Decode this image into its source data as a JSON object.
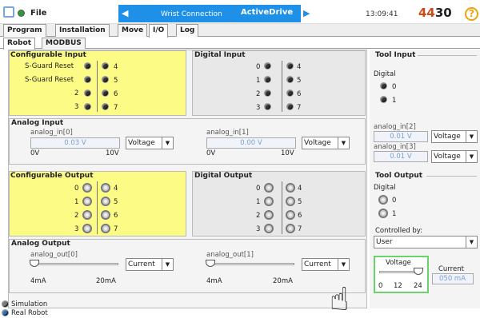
{
  "header": {
    "file_label": "File",
    "tab_wrist": "Wrist Connection",
    "tab_active": "ActiveDrive",
    "clock": "13:09:41",
    "speed_main": "4430",
    "help": "?"
  },
  "tabs": [
    "Program",
    "Installation",
    "Move",
    "I/O",
    "Log"
  ],
  "subtabs": [
    "Robot",
    "MODBUS"
  ],
  "config_input": {
    "title": "Configurable Input",
    "rows": [
      {
        "label": "S-Guard Reset",
        "right": "4"
      },
      {
        "label": "S-Guard Reset",
        "right": "5"
      },
      {
        "label": "2",
        "right": "6"
      },
      {
        "label": "3",
        "right": "7"
      }
    ]
  },
  "digital_input": {
    "title": "Digital Input",
    "rows": [
      {
        "left": "0",
        "right": "4"
      },
      {
        "left": "1",
        "right": "5"
      },
      {
        "left": "2",
        "right": "6"
      },
      {
        "left": "3",
        "right": "7"
      }
    ]
  },
  "tool_input": {
    "title": "Tool Input",
    "digital_label": "Digital",
    "items": [
      "0",
      "1"
    ],
    "analog0_label": "analog_in[2]",
    "analog0_value": "0.01 V",
    "analog0_mode": "Voltage",
    "analog1_label": "analog_in[3]",
    "analog1_value": "0.01 V",
    "analog1_mode": "Voltage"
  },
  "analog_input": {
    "title": "Analog Input",
    "ch0_label": "analog_in[0]",
    "ch0_value": "0.03 V",
    "ch0_mode": "Voltage",
    "ch0_min": "0V",
    "ch0_max": "10V",
    "ch1_label": "analog_in[1]",
    "ch1_value": "0.00 V",
    "ch1_mode": "Voltage",
    "ch1_min": "0V",
    "ch1_max": "10V"
  },
  "config_output": {
    "title": "Configurable Output",
    "rows": [
      {
        "left": "0",
        "right": "4"
      },
      {
        "left": "1",
        "right": "5"
      },
      {
        "left": "2",
        "right": "6"
      },
      {
        "left": "3",
        "right": "7"
      }
    ]
  },
  "digital_output": {
    "title": "Digital Output",
    "rows": [
      {
        "left": "0",
        "right": "4"
      },
      {
        "left": "1",
        "right": "5"
      },
      {
        "left": "2",
        "right": "6"
      },
      {
        "left": "3",
        "right": "7"
      }
    ]
  },
  "tool_output": {
    "title": "Tool Output",
    "digital_label": "Digital",
    "items": [
      "0",
      "1"
    ],
    "controlled_label": "Controlled by:",
    "controlled_value": "User",
    "voltage_label": "Voltage",
    "voltage_ticks": [
      "0",
      "12",
      "24"
    ],
    "current_label": "Current",
    "current_value": "050 mA"
  },
  "analog_output": {
    "title": "Analog Output",
    "ch0_label": "analog_out[0]",
    "ch0_mode": "Current",
    "ch0_min": "4mA",
    "ch0_max": "20mA",
    "ch1_label": "analog_out[1]",
    "ch1_mode": "Current",
    "ch1_min": "4mA",
    "ch1_max": "20mA"
  },
  "status": {
    "simulation": "Simulation",
    "real_robot": "Real Robot"
  }
}
